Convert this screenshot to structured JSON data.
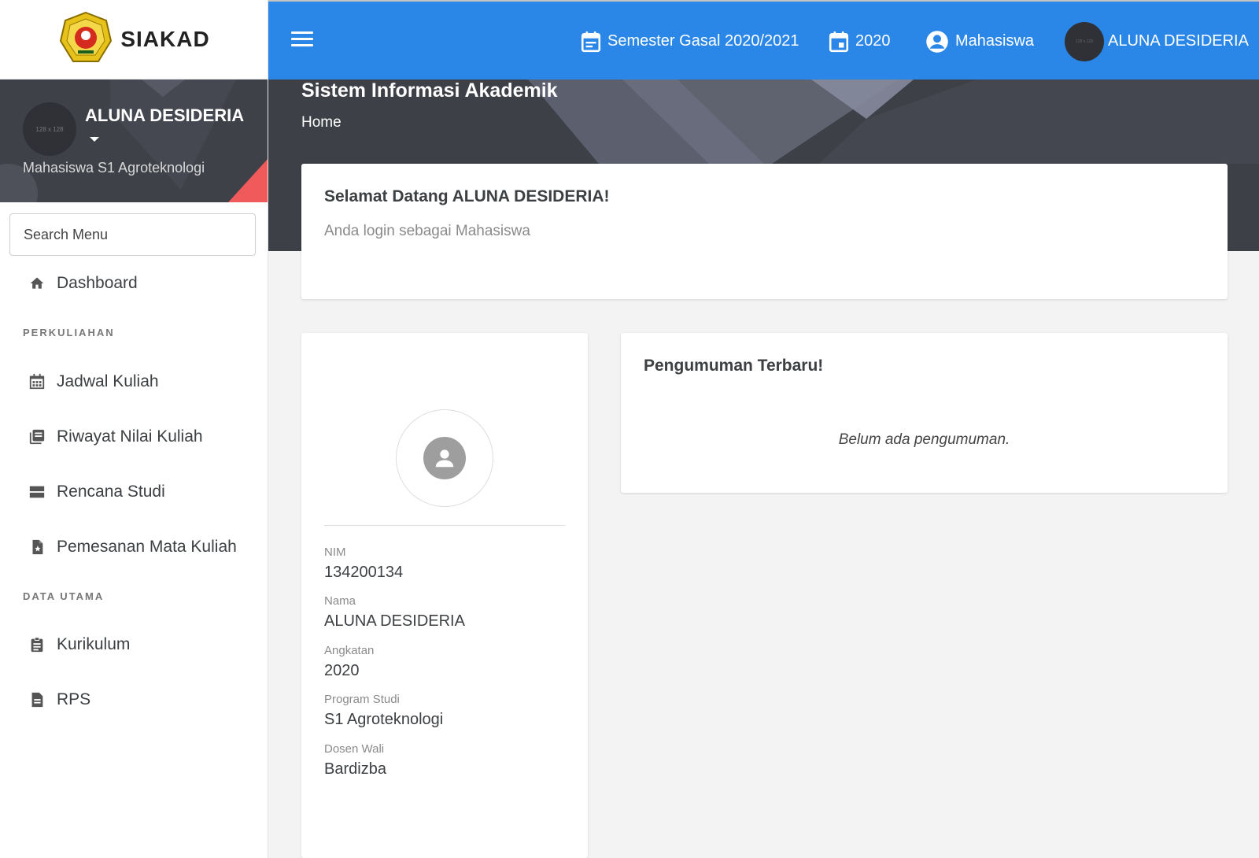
{
  "brand": {
    "name": "SIAKAD",
    "logo_icon": "university-crest-icon"
  },
  "user_panel": {
    "name": "ALUNA DESIDERIA",
    "avatar_text": "128 x 128",
    "role": "Mahasiswa S1 Agroteknologi"
  },
  "search": {
    "placeholder": "Search Menu"
  },
  "menu": {
    "dashboard": "Dashboard",
    "section_perkuliahan": "PERKULIAHAN",
    "jadwal": "Jadwal Kuliah",
    "riwayat": "Riwayat Nilai Kuliah",
    "rencana": "Rencana Studi",
    "pemesanan": "Pemesanan Mata Kuliah",
    "section_data_utama": "DATA UTAMA",
    "kurikulum": "Kurikulum",
    "rps": "RPS"
  },
  "topbar": {
    "semester": "Semester Gasal 2020/2021",
    "year": "2020",
    "role": "Mahasiswa",
    "user": "ALUNA DESIDERIA",
    "avatar_text": "128 x 128"
  },
  "hero": {
    "title": "Sistem Informasi Akademik",
    "breadcrumb": "Home"
  },
  "welcome": {
    "title": "Selamat Datang ALUNA DESIDERIA!",
    "subtitle": "Anda login sebagai Mahasiswa"
  },
  "profile": {
    "nim_label": "NIM",
    "nim": "134200134",
    "nama_label": "Nama",
    "nama": "ALUNA DESIDERIA",
    "angkatan_label": "Angkatan",
    "angkatan": "2020",
    "prodi_label": "Program Studi",
    "prodi": "S1 Agroteknologi",
    "dosen_label": "Dosen Wali",
    "dosen": "Bardizba"
  },
  "announcement": {
    "title": "Pengumuman Terbaru!",
    "empty": "Belum ada pengumuman."
  },
  "colors": {
    "primary": "#2a87e8",
    "dark_panel": "#3d4047",
    "accent_red": "#f05a5a",
    "background": "#f3f3f3"
  }
}
